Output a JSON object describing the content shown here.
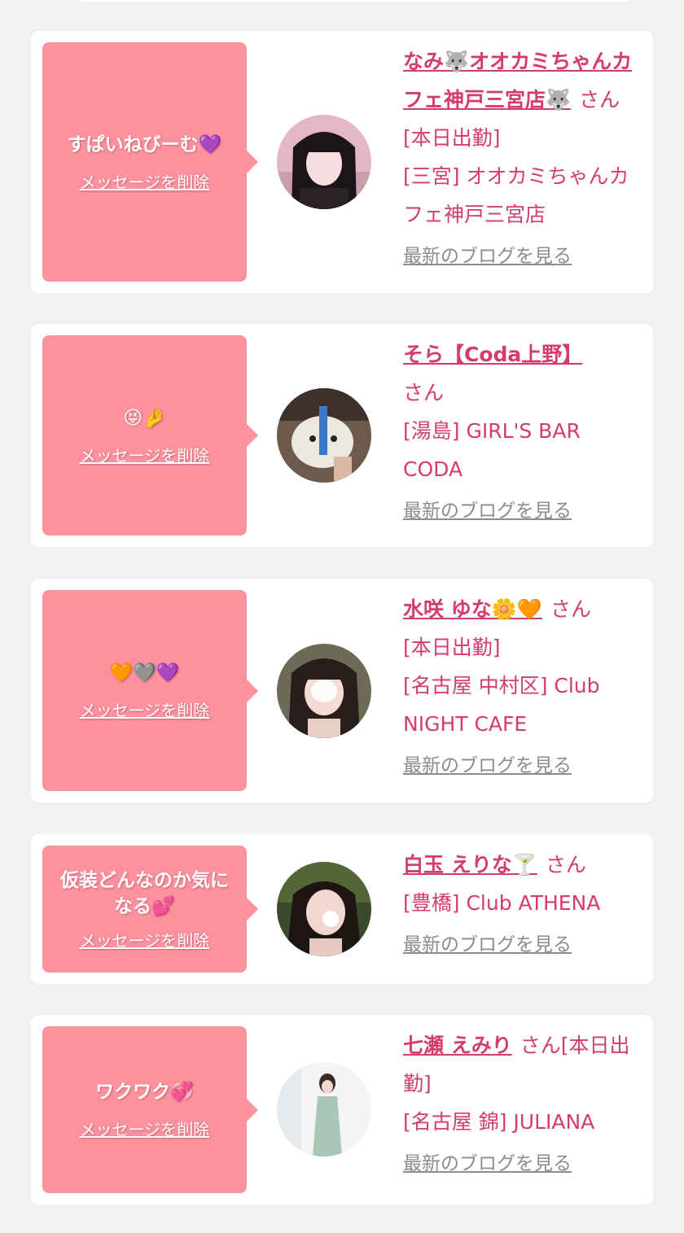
{
  "delete_label": "メッセージを削除",
  "blog_label": "最新のブログを見る",
  "san_label": "さん",
  "cards": [
    {
      "message": "すぱいねびーむ💜",
      "name": "なみ🐺オオカミちゃんカフェ神戸三宮店🐺",
      "status": "[本日出勤]",
      "shop": "[三宮] オオカミちゃんカフェ神戸三宮店"
    },
    {
      "message": "😝🤌",
      "name": "そら【Coda上野】",
      "status": "",
      "shop": "[湯島] GIRL'S BAR CODA"
    },
    {
      "message": "🧡🩶💜",
      "name": "水咲 ゆな🌼🧡",
      "status": "[本日出勤]",
      "shop": "[名古屋 中村区] Club NIGHT CAFE"
    },
    {
      "message": "仮装どんなのか気になる💕",
      "name": "白玉 えりな🍸",
      "status": "",
      "shop": "[豊橋] Club ATHENA"
    },
    {
      "message": "ワクワク💞",
      "name": "七瀬 えみり",
      "status": "[本日出勤]",
      "shop": "[名古屋 錦] JULIANA"
    }
  ]
}
